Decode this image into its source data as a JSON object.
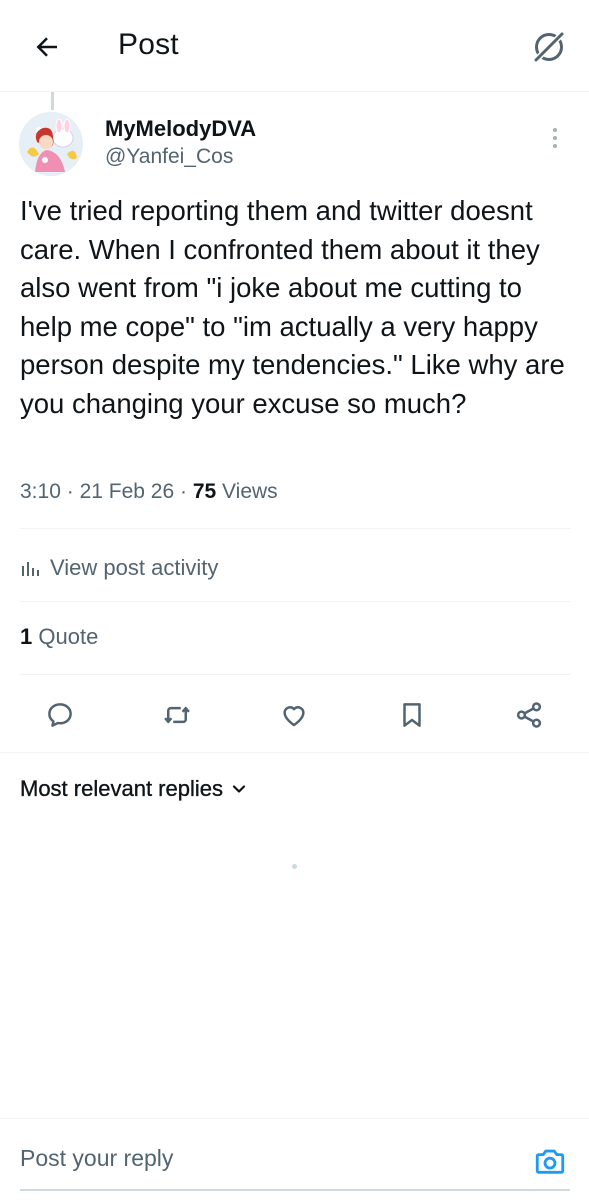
{
  "header": {
    "title": "Post",
    "back_icon": "arrow-left-icon",
    "grok_icon": "grok-icon"
  },
  "post": {
    "author": {
      "display_name": "MyMelodyDVA",
      "handle": "@Yanfei_Cos"
    },
    "text": "I've tried reporting them and twitter doesnt care. When I confronted them about it they also went from \"i joke about me cutting to help me cope\" to \"im actually a very happy person despite my tendencies.\" Like why are you changing your excuse so much?",
    "time": "3:10",
    "separator": "·",
    "date": "21 Feb 26",
    "views_count": "75",
    "views_label": "Views",
    "activity_label": "View post activity",
    "quote_count": "1",
    "quote_label": "Quote"
  },
  "actions": [
    {
      "name": "reply",
      "icon": "reply-icon"
    },
    {
      "name": "repost",
      "icon": "repost-icon"
    },
    {
      "name": "like",
      "icon": "heart-icon"
    },
    {
      "name": "bookmark",
      "icon": "bookmark-icon"
    },
    {
      "name": "share",
      "icon": "share-icon"
    }
  ],
  "replies": {
    "sort_label": "Most relevant replies"
  },
  "reply_bar": {
    "placeholder": "Post your reply"
  },
  "colors": {
    "text_primary": "#0f1419",
    "text_secondary": "#536471",
    "accent": "#1d9bf0",
    "divider": "#eff3f4"
  }
}
